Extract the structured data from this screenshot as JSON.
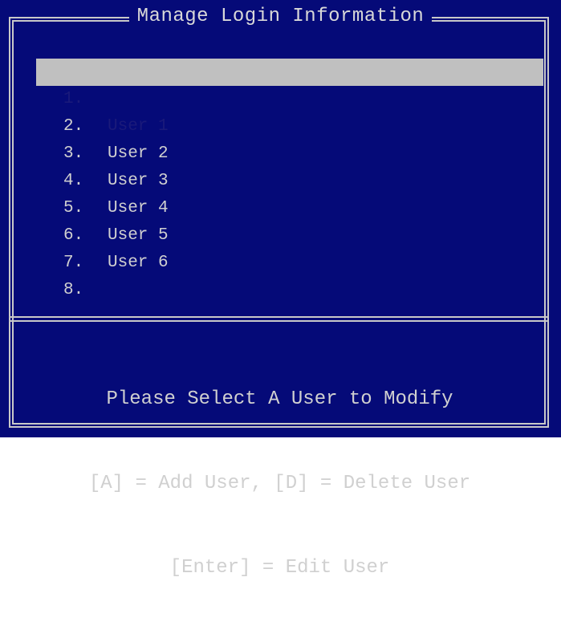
{
  "window": {
    "title": "Manage Login Information"
  },
  "users": [
    {
      "number": "1.",
      "name": "User 1",
      "selected": true
    },
    {
      "number": "2.",
      "name": "User 2",
      "selected": false
    },
    {
      "number": "3.",
      "name": "User 3",
      "selected": false
    },
    {
      "number": "4.",
      "name": "User 4",
      "selected": false
    },
    {
      "number": "5.",
      "name": "User 5",
      "selected": false
    },
    {
      "number": "6.",
      "name": "User 6",
      "selected": false
    },
    {
      "number": "7.",
      "name": "",
      "selected": false
    },
    {
      "number": "8.",
      "name": "",
      "selected": false
    }
  ],
  "help": {
    "line1": "Please Select A User to Modify",
    "line2": "[A] = Add User, [D] = Delete User",
    "line3": "[Enter] = Edit User"
  },
  "colors": {
    "background": "#050a78",
    "text": "#d0d0d0",
    "highlight": "#c0c0c0",
    "highlight_text": "#1a1a7a",
    "border": "#c8c8c8"
  }
}
